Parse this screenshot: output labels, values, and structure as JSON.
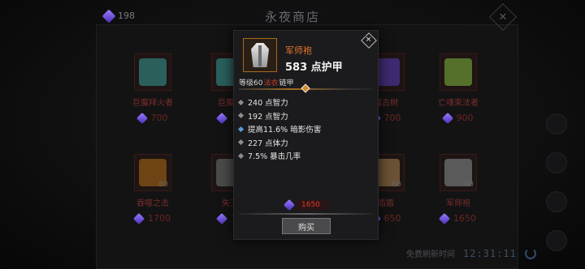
{
  "header": {
    "currency_amount": "198",
    "title": "永夜商店",
    "close_glyph": "✕"
  },
  "items": [
    {
      "name": "巨魔拜火者",
      "price": "700",
      "level": "",
      "icon": "troll-fire-icon",
      "color": "#3e8f8a"
    },
    {
      "name": "巨魔拜",
      "price": "70",
      "level": "",
      "icon": "troll-icon",
      "color": "#3e8f8a"
    },
    {
      "name": "魔古树",
      "price": "700",
      "level": "",
      "icon": "tree-icon",
      "color": "#5b3fa0"
    },
    {
      "name": "亡魂束法者",
      "price": "900",
      "level": "",
      "icon": "spirit-icon",
      "color": "#7ea03c"
    },
    {
      "name": "吞噬之击",
      "price": "1700",
      "level": "60",
      "icon": "blade-icon",
      "color": "#b07020"
    },
    {
      "name": "失王",
      "price": "16",
      "level": "60",
      "icon": "ring-icon",
      "color": "#8c8c8c"
    },
    {
      "name": "盾盾",
      "price": "650",
      "level": "60",
      "icon": "shield-icon",
      "color": "#b58a5a"
    },
    {
      "name": "军师袍",
      "price": "1650",
      "level": "60",
      "icon": "robe-icon",
      "color": "#c8c8c8"
    }
  ],
  "popup": {
    "item_name": "军师袍",
    "armor_text": "583 点护甲",
    "level_prefix": "等级60",
    "level_req": "法衣",
    "level_suffix": "链甲",
    "stats": [
      {
        "text": "240 点智力",
        "special": false
      },
      {
        "text": "192 点智力",
        "special": false
      },
      {
        "text": "提高11.6% 暗影伤害",
        "special": true
      },
      {
        "text": "227 点体力",
        "special": false
      },
      {
        "text": "7.5% 暴击几率",
        "special": false
      }
    ],
    "price": "1650",
    "buy_label": "购买",
    "close_glyph": "✕"
  },
  "footer": {
    "refresh_label": "免费刷新时间",
    "timer": "12:31:11"
  },
  "colors": {
    "item_name_orange": "#e3752a",
    "price_red": "#e23a2e",
    "special_stat_blue": "#5c9ad8"
  }
}
